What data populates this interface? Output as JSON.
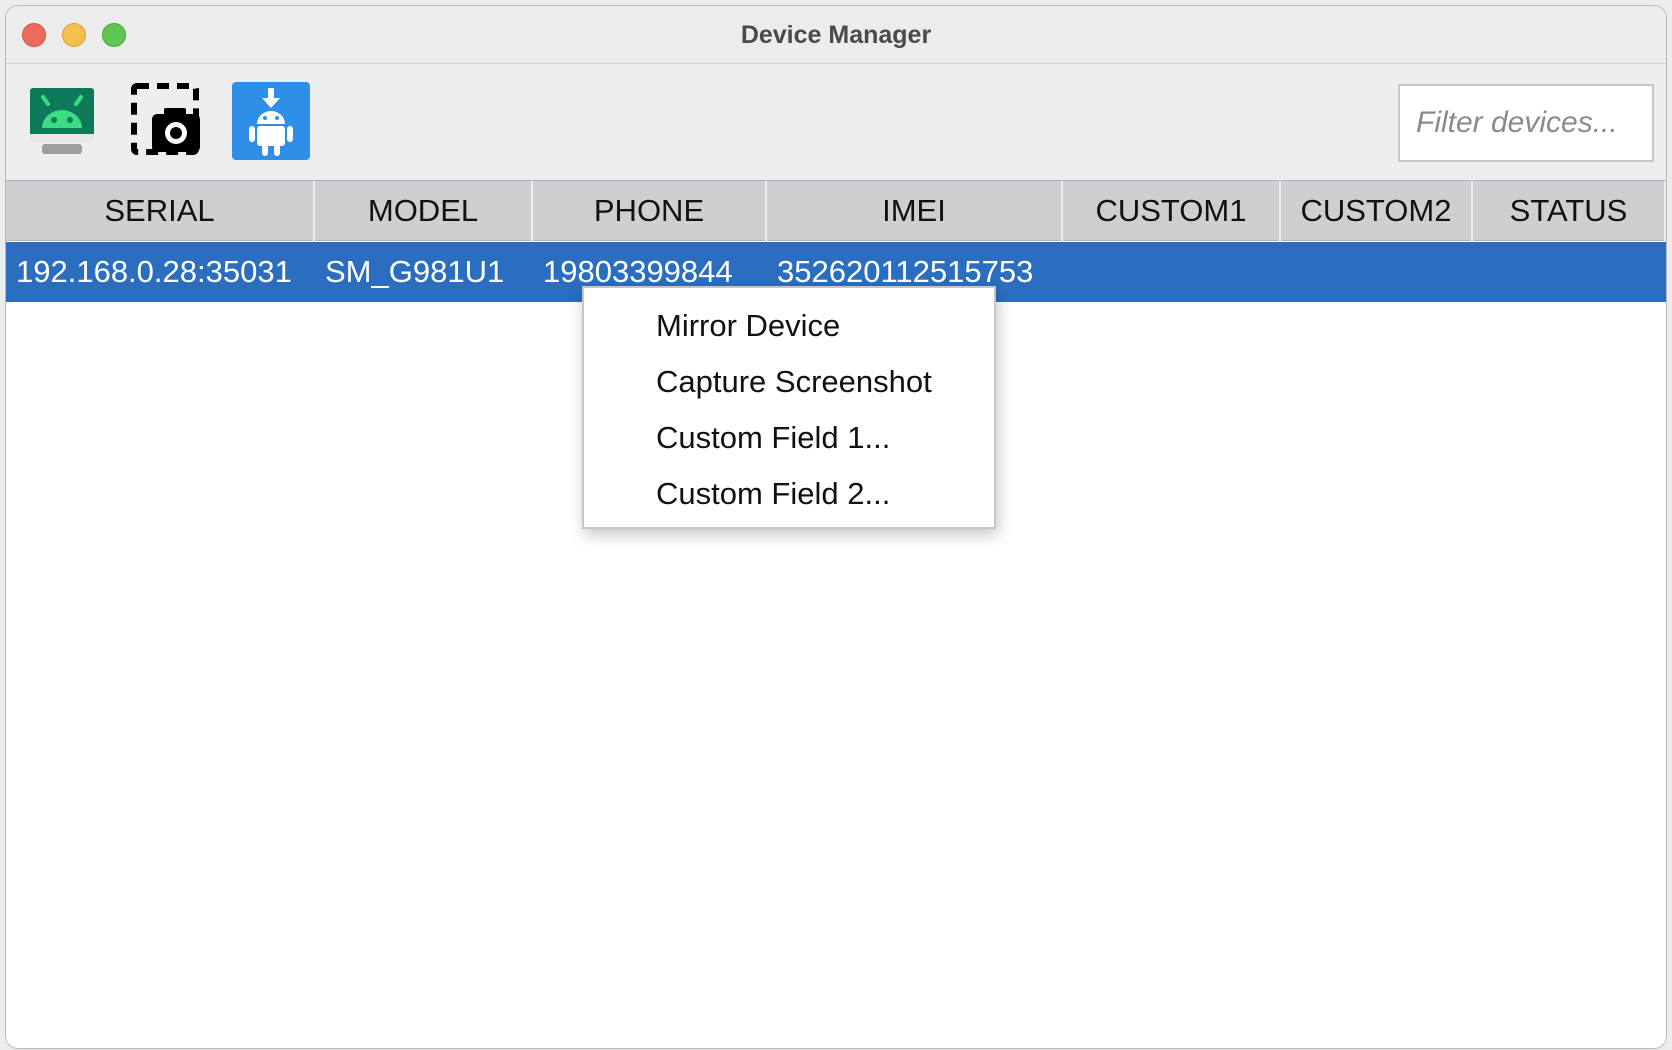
{
  "window": {
    "title": "Device Manager"
  },
  "toolbar": {
    "buttons": [
      {
        "name": "mirror-device",
        "icon": "android-monitor-icon"
      },
      {
        "name": "capture-screenshot",
        "icon": "camera-selection-icon"
      },
      {
        "name": "install-apk",
        "icon": "android-download-icon"
      }
    ],
    "filter_placeholder": "Filter devices..."
  },
  "table": {
    "columns": [
      "SERIAL",
      "MODEL",
      "PHONE",
      "IMEI",
      "CUSTOM1",
      "CUSTOM2",
      "STATUS"
    ],
    "rows": [
      {
        "serial": "192.168.0.28:35031",
        "model": "SM_G981U1",
        "phone": "19803399844",
        "imei": "352620112515753",
        "custom1": "",
        "custom2": "",
        "status": "",
        "selected": true
      }
    ]
  },
  "context_menu": {
    "items": [
      "Mirror Device",
      "Capture Screenshot",
      "Custom Field 1...",
      "Custom Field 2..."
    ]
  },
  "colors": {
    "selection": "#2b6ebf",
    "header_bg": "#cfcfcf",
    "android_green": "#3ddc84",
    "install_blue": "#2f8ee8"
  }
}
